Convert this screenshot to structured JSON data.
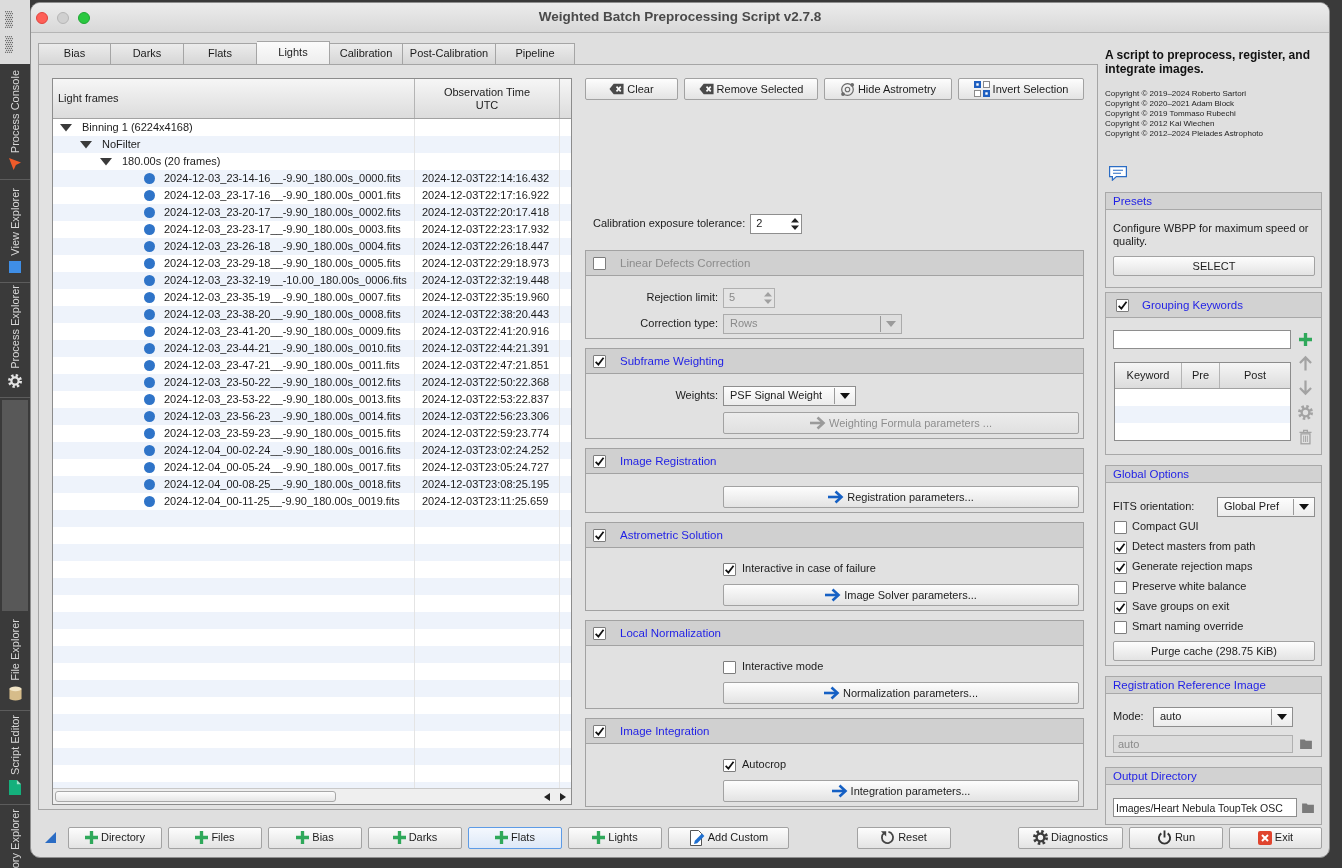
{
  "window": {
    "title": "Weighted Batch Preprocessing Script v2.7.8"
  },
  "dock": {
    "top": [
      {
        "label": "Process Console"
      },
      {
        "label": "View Explorer"
      },
      {
        "label": "Process Explorer"
      }
    ],
    "bottom": [
      {
        "label": "File Explorer"
      },
      {
        "label": "Script Editor"
      },
      {
        "label": "ory Explorer"
      }
    ]
  },
  "tabs": [
    {
      "label": "Bias",
      "selected": false
    },
    {
      "label": "Darks",
      "selected": false
    },
    {
      "label": "Flats",
      "selected": false
    },
    {
      "label": "Lights",
      "selected": true
    },
    {
      "label": "Calibration",
      "selected": false
    },
    {
      "label": "Post-Calibration",
      "selected": false
    },
    {
      "label": "Pipeline",
      "selected": false
    }
  ],
  "frames": {
    "columns": [
      "Light frames",
      "Observation Time\nUTC"
    ],
    "tree": [
      {
        "label": "Binning 1 (6224x4168)",
        "expanded": true,
        "children": [
          {
            "label": "NoFilter",
            "expanded": true,
            "children": [
              {
                "label": "180.00s (20 frames)",
                "expanded": true,
                "children": [
                  {
                    "label": "2024-12-03_23-14-16__-9.90_180.00s_0000.fits",
                    "time": "2024-12-03T22:14:16.432"
                  },
                  {
                    "label": "2024-12-03_23-17-16__-9.90_180.00s_0001.fits",
                    "time": "2024-12-03T22:17:16.922"
                  },
                  {
                    "label": "2024-12-03_23-20-17__-9.90_180.00s_0002.fits",
                    "time": "2024-12-03T22:20:17.418"
                  },
                  {
                    "label": "2024-12-03_23-23-17__-9.90_180.00s_0003.fits",
                    "time": "2024-12-03T22:23:17.932"
                  },
                  {
                    "label": "2024-12-03_23-26-18__-9.90_180.00s_0004.fits",
                    "time": "2024-12-03T22:26:18.447"
                  },
                  {
                    "label": "2024-12-03_23-29-18__-9.90_180.00s_0005.fits",
                    "time": "2024-12-03T22:29:18.973"
                  },
                  {
                    "label": "2024-12-03_23-32-19__-10.00_180.00s_0006.fits",
                    "time": "2024-12-03T22:32:19.448"
                  },
                  {
                    "label": "2024-12-03_23-35-19__-9.90_180.00s_0007.fits",
                    "time": "2024-12-03T22:35:19.960"
                  },
                  {
                    "label": "2024-12-03_23-38-20__-9.90_180.00s_0008.fits",
                    "time": "2024-12-03T22:38:20.443"
                  },
                  {
                    "label": "2024-12-03_23-41-20__-9.90_180.00s_0009.fits",
                    "time": "2024-12-03T22:41:20.916"
                  },
                  {
                    "label": "2024-12-03_23-44-21__-9.90_180.00s_0010.fits",
                    "time": "2024-12-03T22:44:21.391"
                  },
                  {
                    "label": "2024-12-03_23-47-21__-9.90_180.00s_0011.fits",
                    "time": "2024-12-03T22:47:21.851"
                  },
                  {
                    "label": "2024-12-03_23-50-22__-9.90_180.00s_0012.fits",
                    "time": "2024-12-03T22:50:22.368"
                  },
                  {
                    "label": "2024-12-03_23-53-22__-9.90_180.00s_0013.fits",
                    "time": "2024-12-03T22:53:22.837"
                  },
                  {
                    "label": "2024-12-03_23-56-23__-9.90_180.00s_0014.fits",
                    "time": "2024-12-03T22:56:23.306"
                  },
                  {
                    "label": "2024-12-03_23-59-23__-9.90_180.00s_0015.fits",
                    "time": "2024-12-03T22:59:23.774"
                  },
                  {
                    "label": "2024-12-04_00-02-24__-9.90_180.00s_0016.fits",
                    "time": "2024-12-03T23:02:24.252"
                  },
                  {
                    "label": "2024-12-04_00-05-24__-9.90_180.00s_0017.fits",
                    "time": "2024-12-03T23:05:24.727"
                  },
                  {
                    "label": "2024-12-04_00-08-25__-9.90_180.00s_0018.fits",
                    "time": "2024-12-03T23:08:25.195"
                  },
                  {
                    "label": "2024-12-04_00-11-25__-9.90_180.00s_0019.fits",
                    "time": "2024-12-03T23:11:25.659"
                  }
                ]
              }
            ]
          }
        ]
      }
    ]
  },
  "file_buttons": [
    {
      "label": "Clear"
    },
    {
      "label": "Remove Selected"
    },
    {
      "label": "Hide Astrometry"
    },
    {
      "label": "Invert Selection"
    }
  ],
  "calibration_tolerance": {
    "label": "Calibration exposure tolerance:",
    "value": "2"
  },
  "sections": [
    {
      "title": "Linear Defects Correction",
      "checked": false,
      "rows": [
        {
          "kind": "spin",
          "label": "Rejection limit:",
          "value": "5",
          "disabled": true
        },
        {
          "kind": "combo",
          "label": "Correction type:",
          "value": "Rows",
          "disabled": true
        }
      ]
    },
    {
      "title": "Subframe Weighting",
      "checked": true,
      "rows": [
        {
          "kind": "combo",
          "label": "Weights:",
          "value": "PSF Signal Weight",
          "disabled": false
        },
        {
          "kind": "button",
          "label": "Weighting Formula parameters ...",
          "disabled": true
        }
      ]
    },
    {
      "title": "Image Registration",
      "checked": true,
      "rows": [
        {
          "kind": "button",
          "label": "Registration parameters...",
          "disabled": false
        }
      ]
    },
    {
      "title": "Astrometric Solution",
      "checked": true,
      "rows": [
        {
          "kind": "checkbox",
          "label": "Interactive in case of failure",
          "checked": true,
          "disabled": false
        },
        {
          "kind": "button",
          "label": "Image Solver parameters...",
          "disabled": false
        }
      ]
    },
    {
      "title": "Local Normalization",
      "checked": true,
      "rows": [
        {
          "kind": "checkbox",
          "label": "Interactive mode",
          "checked": false,
          "disabled": false
        },
        {
          "kind": "button",
          "label": "Normalization parameters...",
          "disabled": false
        }
      ]
    },
    {
      "title": "Image Integration",
      "checked": true,
      "rows": [
        {
          "kind": "checkbox",
          "label": "Autocrop",
          "checked": true,
          "disabled": false
        },
        {
          "kind": "button",
          "label": "Integration parameters...",
          "disabled": false
        }
      ]
    }
  ],
  "about": {
    "heading": "A script to preprocess, register, and integrate images.",
    "copyright": [
      "Copyright © 2019–2024 Roberto Sartori",
      "Copyright © 2020–2021 Adam Block",
      "Copyright © 2019 Tommaso Rubechi",
      "Copyright © 2012 Kai Wiechen",
      "Copyright © 2012–2024 Pleiades Astrophoto"
    ]
  },
  "presets": {
    "title": "Presets",
    "description": "Configure WBPP for maximum speed or quality.",
    "button": "SELECT"
  },
  "grouping_keywords": {
    "title": "Grouping Keywords",
    "checked": true,
    "columns": [
      "Keyword",
      "Pre",
      "Post"
    ],
    "tools": [
      {
        "disabled": false
      },
      {
        "disabled": true
      },
      {
        "disabled": true
      },
      {
        "disabled": true
      },
      {
        "disabled": true
      }
    ]
  },
  "global_options": {
    "title": "Global Options",
    "fits_orientation": {
      "label": "FITS orientation:",
      "value": "Global Pref"
    },
    "options": [
      {
        "label": "Compact GUI",
        "checked": false
      },
      {
        "label": "Detect masters from path",
        "checked": true
      },
      {
        "label": "Generate rejection maps",
        "checked": true
      },
      {
        "label": "Preserve white balance",
        "checked": false
      },
      {
        "label": "Save groups on exit",
        "checked": true
      },
      {
        "label": "Smart naming override",
        "checked": false
      }
    ],
    "purge_button": "Purge cache (298.75 KiB)"
  },
  "registration_reference": {
    "title": "Registration Reference Image",
    "mode": {
      "label": "Mode:",
      "value": "auto"
    },
    "reference": {
      "value": "auto",
      "disabled": true
    }
  },
  "output_directory": {
    "title": "Output Directory",
    "value": "Images/Heart Nebula ToupTek OSC"
  },
  "add_buttons": [
    {
      "kind": "add",
      "label": "Directory",
      "focused": false
    },
    {
      "kind": "add",
      "label": "Files",
      "focused": false
    },
    {
      "kind": "add",
      "label": "Bias",
      "focused": false
    },
    {
      "kind": "add",
      "label": "Darks",
      "focused": false
    },
    {
      "kind": "add",
      "label": "Flats",
      "focused": true
    },
    {
      "kind": "add",
      "label": "Lights",
      "focused": false
    },
    {
      "kind": "custom",
      "label": "Add Custom",
      "focused": false
    }
  ],
  "reset_button": {
    "label": "Reset"
  },
  "dialog_buttons": [
    {
      "label": "Diagnostics"
    },
    {
      "label": "Run"
    },
    {
      "label": "Exit"
    }
  ]
}
